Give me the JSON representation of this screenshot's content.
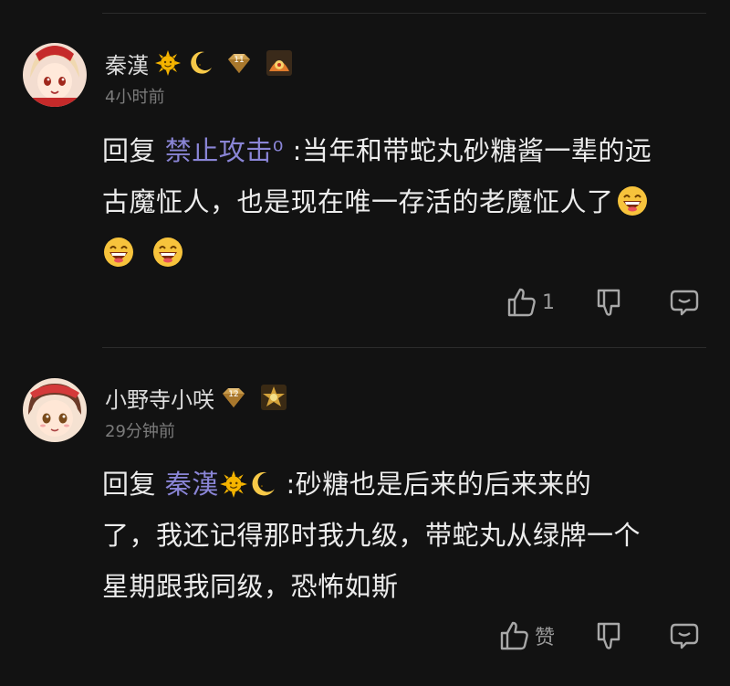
{
  "comments": [
    {
      "username": "秦漢",
      "time": "4小时前",
      "level_badge": "11",
      "reply_prefix": "回复",
      "reply_to": "禁止攻击⁰",
      "text_line1": ":当年和带蛇丸砂糖酱一辈的远",
      "text_line2": "古魔怔人，也是现在唯一存活的老魔怔人了",
      "like_count": "1",
      "icons": [
        "sun-emoji",
        "moon-emoji",
        "level-diamond-badge",
        "fan-medal-badge",
        "laughing-emoji"
      ]
    },
    {
      "username": "小野寺小咲",
      "time": "29分钟前",
      "level_badge": "12",
      "reply_prefix": "回复",
      "reply_to": "秦漢",
      "text_line1": ":砂糖也是后来的后来来的",
      "text_line2": "了，我还记得那时我九级，带蛇丸从绿牌一个",
      "text_line3": "星期跟我同级，恐怖如斯",
      "like_label": "赞",
      "icons": [
        "level-diamond-badge",
        "gold-medal-badge",
        "sun-emoji",
        "moon-emoji"
      ]
    }
  ],
  "colors": {
    "background": "#121212",
    "text": "#ececec",
    "reply_name": "#8a85d6",
    "timestamp": "#7b7b7b"
  }
}
